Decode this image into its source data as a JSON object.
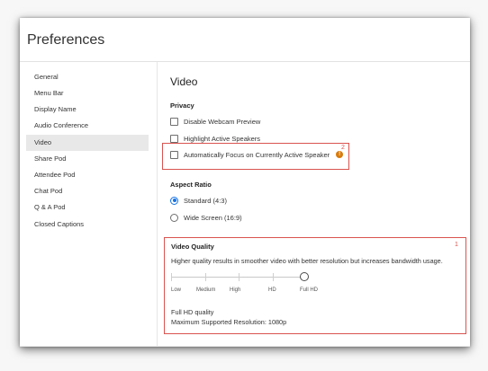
{
  "window": {
    "title": "Preferences"
  },
  "sidebar": {
    "items": [
      {
        "label": "General"
      },
      {
        "label": "Menu Bar"
      },
      {
        "label": "Display Name"
      },
      {
        "label": "Audio Conference"
      },
      {
        "label": "Video",
        "selected": true
      },
      {
        "label": "Share Pod"
      },
      {
        "label": "Attendee Pod"
      },
      {
        "label": "Chat Pod"
      },
      {
        "label": "Q & A Pod"
      },
      {
        "label": "Closed Captions"
      }
    ]
  },
  "main": {
    "heading": "Video",
    "privacy": {
      "title": "Privacy",
      "options": [
        {
          "label": "Disable Webcam Preview",
          "checked": false
        },
        {
          "label": "Highlight Active Speakers",
          "checked": false
        },
        {
          "label": "Automatically Focus on Currently Active Speaker",
          "checked": false
        }
      ],
      "info_icon": "info-icon",
      "callout_number": "2"
    },
    "aspect_ratio": {
      "title": "Aspect Ratio",
      "options": [
        {
          "label": "Standard (4:3)",
          "selected": true
        },
        {
          "label": "Wide Screen (16:9)",
          "selected": false
        }
      ]
    },
    "video_quality": {
      "title": "Video Quality",
      "callout_number": "1",
      "description": "Higher quality results in smoother video with better resolution but increases bandwidth usage.",
      "levels": [
        "Low",
        "Medium",
        "High",
        "HD",
        "Full HD"
      ],
      "selected_level": "Full HD",
      "current_quality": "Full HD quality",
      "max_resolution": "Maximum Supported Resolution: 1080p"
    }
  },
  "colors": {
    "accent": "#1473e6",
    "callout": "#d9534f",
    "warning": "#d97b0b"
  }
}
